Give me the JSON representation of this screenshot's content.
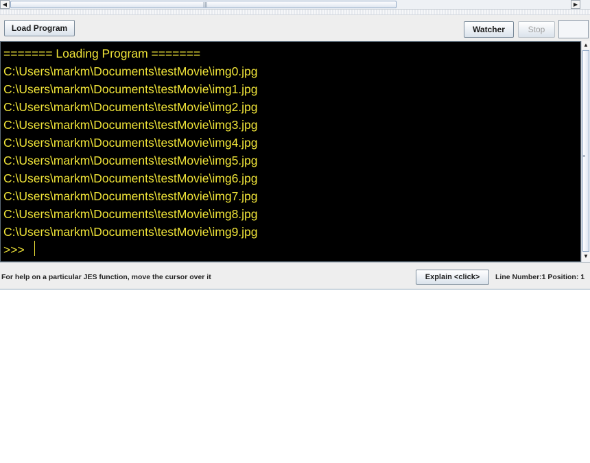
{
  "toolbar": {
    "load_program_label": "Load Program",
    "watcher_label": "Watcher",
    "stop_label": "Stop"
  },
  "console": {
    "lines": [
      "======= Loading Program =======",
      "C:\\Users\\markm\\Documents\\testMovie\\img0.jpg",
      "C:\\Users\\markm\\Documents\\testMovie\\img1.jpg",
      "C:\\Users\\markm\\Documents\\testMovie\\img2.jpg",
      "C:\\Users\\markm\\Documents\\testMovie\\img3.jpg",
      "C:\\Users\\markm\\Documents\\testMovie\\img4.jpg",
      "C:\\Users\\markm\\Documents\\testMovie\\img5.jpg",
      "C:\\Users\\markm\\Documents\\testMovie\\img6.jpg",
      "C:\\Users\\markm\\Documents\\testMovie\\img7.jpg",
      "C:\\Users\\markm\\Documents\\testMovie\\img8.jpg",
      "C:\\Users\\markm\\Documents\\testMovie\\img9.jpg"
    ],
    "prompt": ">>>",
    "text_color": "#f0e438",
    "background_color": "#000000"
  },
  "status": {
    "help_text": "For help on a particular JES function, move the cursor over it",
    "explain_label": "Explain <click>",
    "position_text": "Line Number:1 Position: 1"
  },
  "icons": {
    "scroll_left": "arrow-left-icon",
    "scroll_right": "arrow-right-icon",
    "scroll_up": "arrow-up-icon",
    "scroll_down": "arrow-down-icon"
  }
}
